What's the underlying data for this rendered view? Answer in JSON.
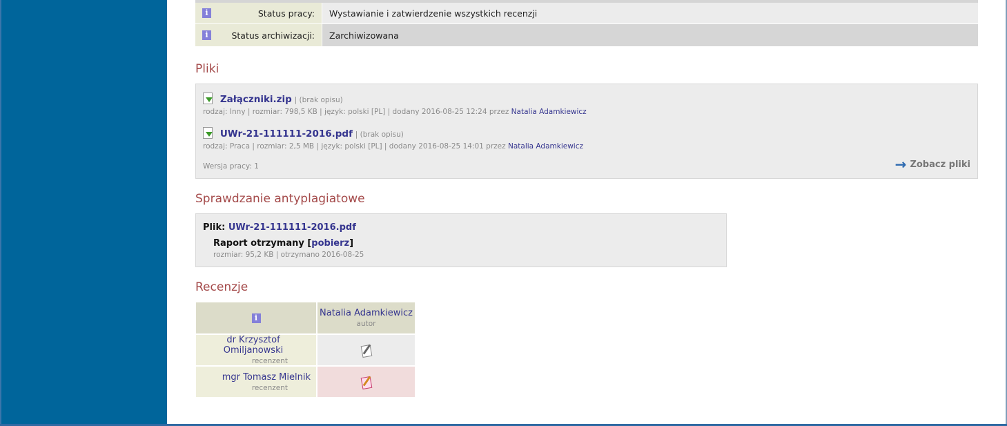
{
  "info": {
    "rows": [
      {
        "label": "Status pracy:",
        "value": "Wystawianie i zatwierdzenie wszystkich recenzji"
      },
      {
        "label": "Status archiwizacji:",
        "value": "Zarchiwizowana"
      }
    ]
  },
  "files_section": {
    "title": "Pliki",
    "files": [
      {
        "name": "Załączniki.zip",
        "desc": "| (brak opisu)",
        "meta": "rodzaj: Inny | rozmiar: 798,5 KB | język: polski [PL] | dodany 2016-08-25 12:24 przez",
        "author": "Natalia Adamkiewicz"
      },
      {
        "name": "UWr-21-111111-2016.pdf",
        "desc": "| (brak opisu)",
        "meta": "rodzaj: Praca | rozmiar: 2,5 MB | język: polski [PL] | dodany 2016-08-25 14:01 przez",
        "author": "Natalia Adamkiewicz"
      }
    ],
    "version": "Wersja pracy: 1",
    "see_files": "Zobacz pliki"
  },
  "plagiarism": {
    "title": "Sprawdzanie antyplagiatowe",
    "file_label": "Plik:",
    "file_name": "UWr-21-111111-2016.pdf",
    "report_label": "Raport otrzymany",
    "download": "pobierz",
    "meta": "rozmiar: 95,2 KB | otrzymano 2016-08-25"
  },
  "reviews": {
    "title": "Recenzje",
    "author_name": "Natalia Adamkiewicz",
    "author_role": "autor",
    "reviewers": [
      {
        "name": "dr Krzysztof Omiljanowski",
        "role": "recenzent",
        "status_icon": "review-icon"
      },
      {
        "name": "mgr Tomasz Mielnik",
        "role": "recenzent",
        "status_icon": "review-pending-icon"
      }
    ]
  },
  "colors": {
    "sidebar": "#00659b",
    "section_title": "#a44a4a",
    "link": "#35358f"
  }
}
